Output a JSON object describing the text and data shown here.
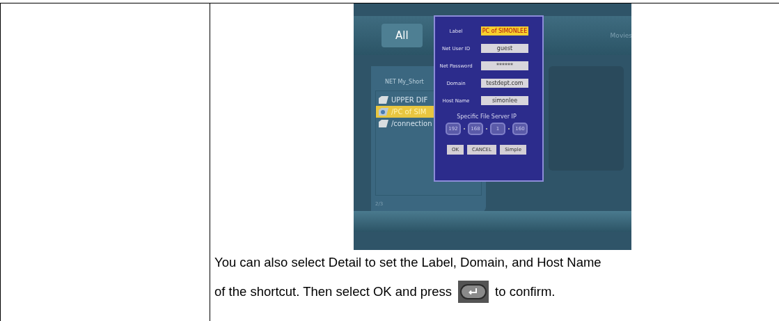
{
  "tv_screen": {
    "tabs": [
      {
        "label": "All",
        "selected": true
      },
      {
        "label": "Movies",
        "selected": false
      }
    ],
    "path": "NET  My_Short",
    "files": [
      {
        "name": "UPPER DIF",
        "kind": "folder",
        "selected": false
      },
      {
        "name": "/PC of SIM",
        "kind": "network",
        "selected": true
      },
      {
        "name": "/connection",
        "kind": "folder",
        "selected": false
      }
    ],
    "page": "2/3",
    "dialog": {
      "fields": [
        {
          "label": "Label",
          "value": "PC of SIMONLEE",
          "selected": true
        },
        {
          "label": "Net User ID",
          "value": "guest",
          "selected": false
        },
        {
          "label": "Net Password",
          "value": "******",
          "selected": false
        },
        {
          "label": "Domain",
          "value": "testdept.com",
          "selected": false
        },
        {
          "label": "Host Name",
          "value": "simonlee",
          "selected": false
        }
      ],
      "ip_title": "Specific File Server IP",
      "ip": [
        "192",
        "168",
        "1",
        "160"
      ],
      "buttons": [
        "OK",
        "CANCEL",
        "Simple"
      ]
    }
  },
  "instructions": {
    "line_1": "You can also select Detail to set the Label, Domain, and Host Name",
    "line_2_before": "of the shortcut. Then select OK and press",
    "line_2_after": "to confirm."
  }
}
